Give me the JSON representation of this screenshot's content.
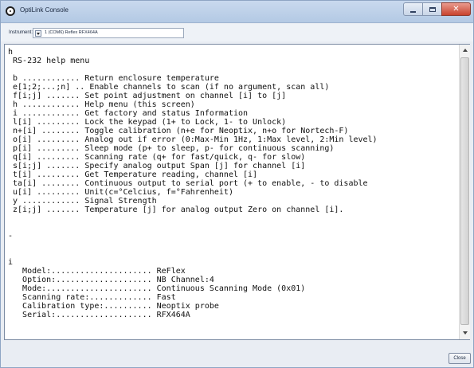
{
  "window": {
    "title": "OptiLink Console"
  },
  "instrument": {
    "label": "Instrument:",
    "selected": "1 (COM6) Reflex  RFX464A"
  },
  "console": {
    "lines": [
      "h",
      " RS-232 help menu",
      "",
      " b ............ Return enclosure temperature",
      " e[1;2;...;n] .. Enable channels to scan (if no argument, scan all)",
      " f[i;j] ....... Set point adjustment on channel [i] to [j]",
      " h ............ Help menu (this screen)",
      " i ............ Get factory and status Information",
      " l[i] ......... Lock the keypad (1+ to Lock, 1- to Unlock)",
      " n+[i] ........ Toggle calibration (n+e for Neoptix, n+o for Nortech-F)",
      " o[i] ......... Analog out if error (0:Max-Min 1Hz, 1:Max level, 2:Min level)",
      " p[i] ......... Sleep mode (p+ to sleep, p- for continuous scanning)",
      " q[i] ......... Scanning rate (q+ for fast/quick, q- for slow)",
      " s[i;j] ....... Specify analog output Span [j] for channel [i]",
      " t[i] ......... Get Temperature reading, channel [i]",
      " ta[i] ........ Continuous output to serial port (+ to enable, - to disable",
      " u[i] ......... Unit(c=°Celcius, f=°Fahrenheit)",
      " y ............ Signal Strength",
      " z[i;j] ....... Temperature [j] for analog output Zero on channel [i].",
      "",
      "",
      "-",
      "",
      "",
      "i",
      "   Model:..................... ReFlex",
      "   Option:.................... NB Channel:4",
      "   Mode:...................... Continuous Scanning Mode (0x01)",
      "   Scanning rate:............. Fast",
      "   Calibration type:.......... Neoptix probe",
      "   Serial:.................... RFX464A"
    ]
  },
  "footer": {
    "close_label": "Close"
  },
  "icons": {
    "app": "optilink-app-icon",
    "minimize": "minimize-icon",
    "maximize": "maximize-icon",
    "close": "close-icon",
    "dropdown": "chevron-down-icon",
    "scroll_up": "scroll-up-icon",
    "scroll_down": "scroll-down-icon"
  },
  "colors": {
    "title_bar": "#b3c9e4",
    "close_button": "#c8432e",
    "console_bg": "#ffffff",
    "window_bg": "#e9edf3"
  }
}
